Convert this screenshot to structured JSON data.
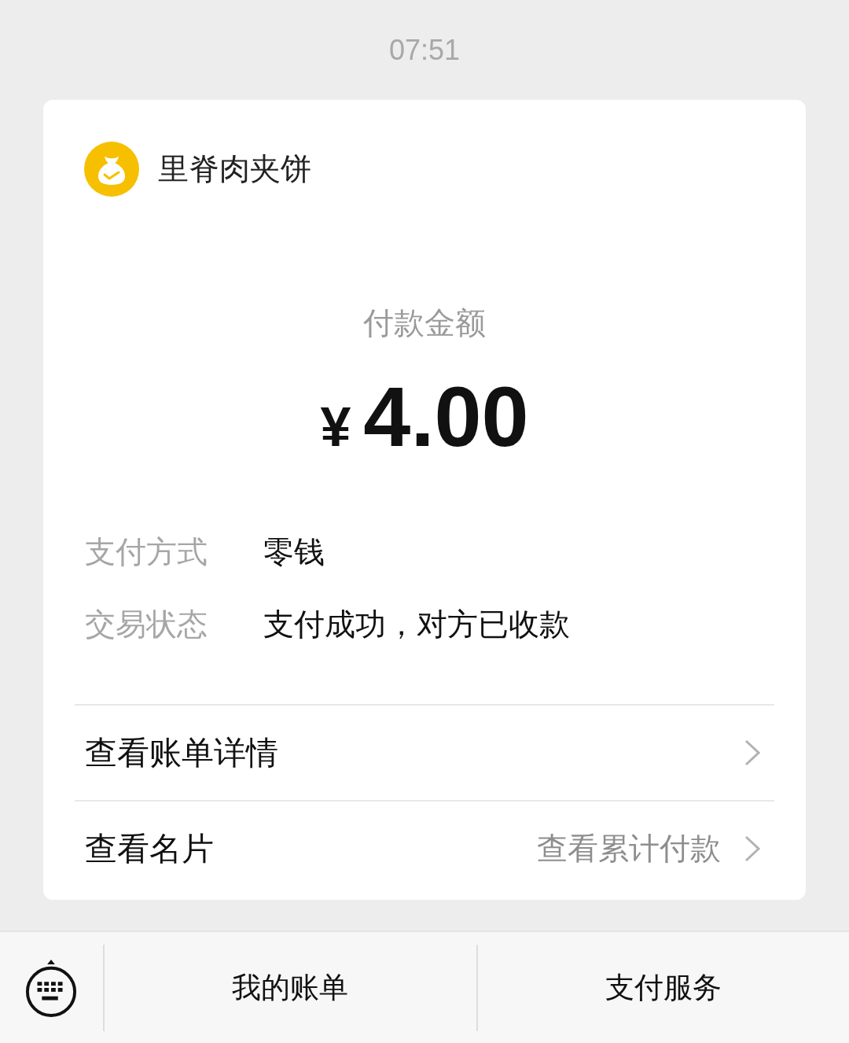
{
  "time": "07:51",
  "merchant": {
    "name": "里脊肉夹饼"
  },
  "amount": {
    "label": "付款金额",
    "currency": "¥",
    "value": "4.00"
  },
  "details": [
    {
      "label": "支付方式",
      "value": "零钱"
    },
    {
      "label": "交易状态",
      "value": "支付成功，对方已收款"
    }
  ],
  "links": [
    {
      "label": "查看账单详情"
    },
    {
      "label": "查看名片",
      "hint": "查看累计付款"
    }
  ],
  "bottom_bar": {
    "menus": [
      "我的账单",
      "支付服务"
    ]
  }
}
